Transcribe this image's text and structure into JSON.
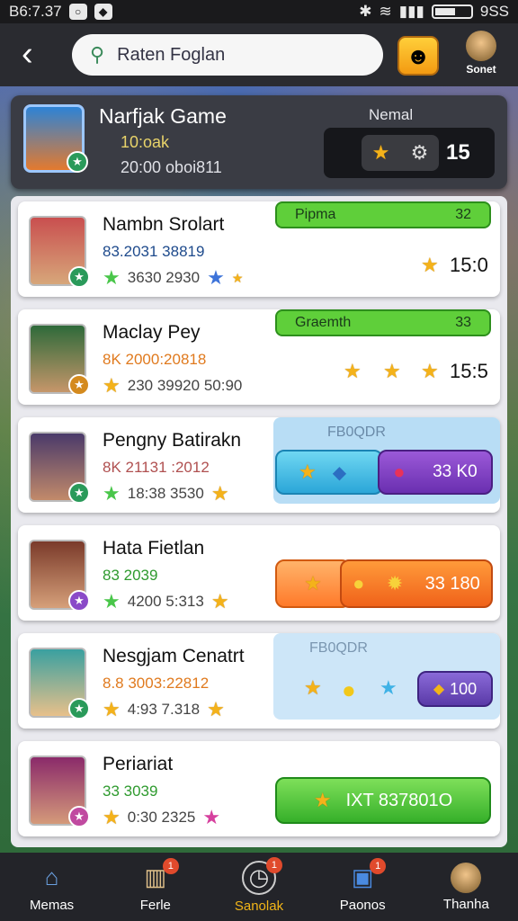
{
  "status_bar": {
    "time": "B6:7.37",
    "battery_text": "9SS"
  },
  "top_bar": {
    "search_placeholder": "Raten Foglan",
    "profile_label": "Sonet"
  },
  "header": {
    "title": "Narfjak Game",
    "line1": "10:oak",
    "line2": "20:00 oboi811",
    "label": "Nemal",
    "value": "15"
  },
  "rows": [
    {
      "name": "Nambn Srolart",
      "sub": "83.2031 38819",
      "sub_color": "#1e4a8c",
      "meta": "3630 2930",
      "pill": {
        "label": "Pipma",
        "value": "32"
      },
      "right_value": "15:0"
    },
    {
      "name": "Maclay Pey",
      "sub": "8K 2000:20818",
      "sub_color": "#e07a1e",
      "meta": "230 39920 50:90",
      "pill": {
        "label": "Graemth",
        "value": "33"
      },
      "right_value": "15:5"
    },
    {
      "name": "Pengny Batirakn",
      "sub": "8K 21131 :2012",
      "sub_color": "#b05050",
      "meta": "18:38 3530",
      "panel_label": "FB0QDR",
      "btn_value": "33 K0"
    },
    {
      "name": "Hata Fietlan",
      "sub": "83 2039",
      "sub_color": "#2e9a2e",
      "meta": "4200 5:313",
      "btn_value": "33 180"
    },
    {
      "name": "Nesgjam Cenatrt",
      "sub": "8.8 3003:22812",
      "sub_color": "#e07a1e",
      "meta": "4:93 7.318",
      "panel_label": "FB0QDR",
      "btn_value": "100"
    },
    {
      "name": "Periariat",
      "sub": "33 3039",
      "sub_color": "#2e9a2e",
      "meta": "0:30 2325",
      "btn_value": "IXT 837801O"
    }
  ],
  "bottom_nav": [
    {
      "label": "Memas",
      "icon": "house-icon"
    },
    {
      "label": "Ferle",
      "icon": "bars-icon"
    },
    {
      "label": "Sanolak",
      "icon": "clock-icon"
    },
    {
      "label": "Paonos",
      "icon": "bag-icon"
    },
    {
      "label": "Thanha",
      "icon": "person-icon"
    }
  ]
}
